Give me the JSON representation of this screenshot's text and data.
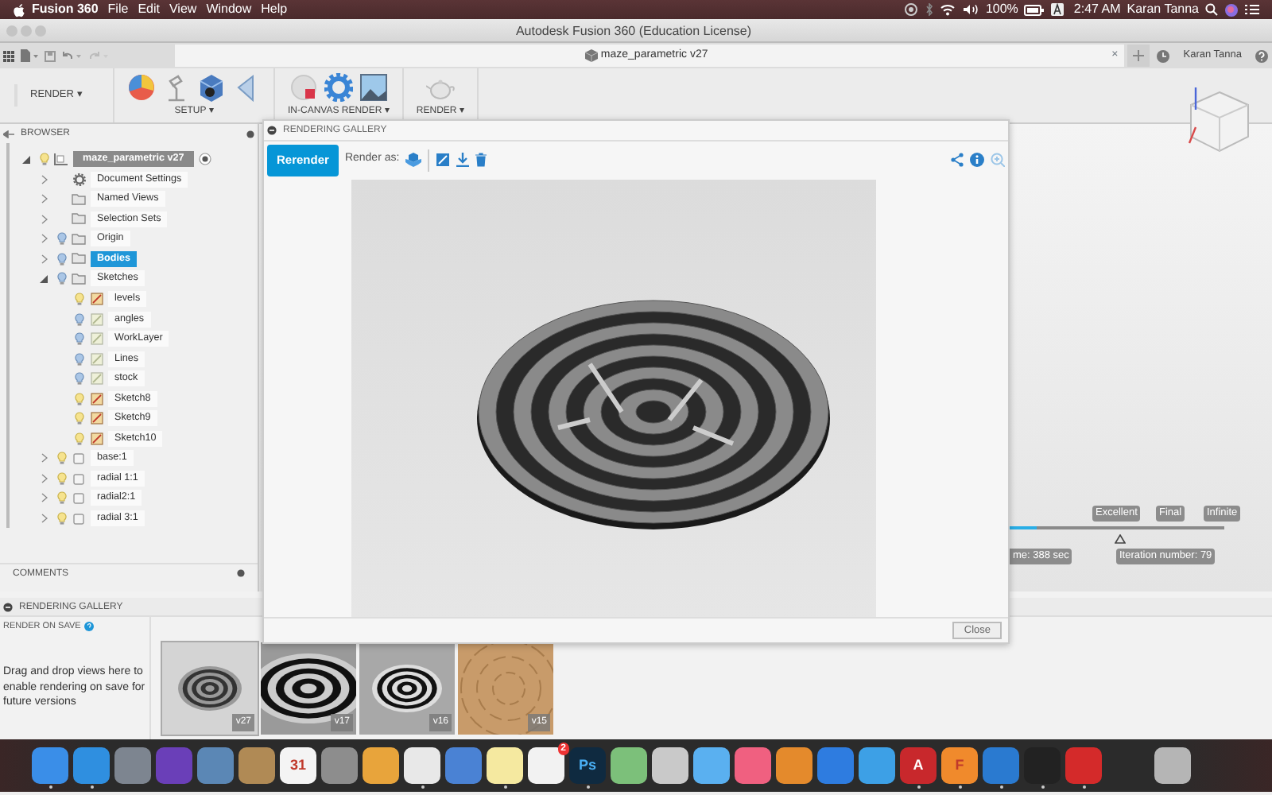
{
  "menu_bar": {
    "app": "Fusion 360",
    "menus": [
      "File",
      "Edit",
      "View",
      "Window",
      "Help"
    ],
    "battery": "100%",
    "clock": "2:47 AM",
    "user": "Karan Tanna"
  },
  "window": {
    "title": "Autodesk Fusion 360 (Education License)"
  },
  "document_tab": {
    "title": "maze_parametric v27",
    "close": "×"
  },
  "account": {
    "user": "Karan Tanna"
  },
  "toolbar": {
    "workspace": "RENDER ▾",
    "groups": [
      {
        "label": "SETUP ▾",
        "tools": [
          {
            "kind": "appearance"
          },
          {
            "kind": "lamp"
          },
          {
            "kind": "cube"
          },
          {
            "kind": "wedge"
          }
        ]
      },
      {
        "label": "IN-CANVAS RENDER ▾",
        "tools": [
          {
            "kind": "sphere"
          },
          {
            "kind": "gear"
          },
          {
            "kind": "picture"
          }
        ]
      },
      {
        "label": "RENDER ▾",
        "tools": [
          {
            "kind": "teapot"
          }
        ]
      }
    ]
  },
  "browser": {
    "title": "BROWSER",
    "tree": [
      {
        "label": "maze_parametric v27",
        "kind": "component",
        "visible": true,
        "expanded": true,
        "selected": false,
        "children": [
          {
            "label": "Document Settings",
            "kind": "settings",
            "expanded": false,
            "selected": false
          },
          {
            "label": "Named Views",
            "kind": "folder",
            "expanded": false,
            "selected": false
          },
          {
            "label": "Selection Sets",
            "kind": "folder",
            "expanded": false,
            "selected": false
          },
          {
            "label": "Origin",
            "kind": "folder",
            "visible": false,
            "expanded": false,
            "selected": false
          },
          {
            "label": "Bodies",
            "kind": "folder",
            "visible": false,
            "expanded": false,
            "selected": true
          },
          {
            "label": "Sketches",
            "kind": "folder",
            "visible": false,
            "expanded": true,
            "selected": false,
            "children": [
              {
                "label": "levels",
                "kind": "sketch",
                "visible": true,
                "selected": false
              },
              {
                "label": "angles",
                "kind": "sketch",
                "visible": false,
                "selected": false
              },
              {
                "label": "WorkLayer",
                "kind": "sketch",
                "visible": false,
                "selected": false
              },
              {
                "label": "Lines",
                "kind": "sketch",
                "visible": false,
                "selected": false
              },
              {
                "label": "stock",
                "kind": "sketch",
                "visible": false,
                "selected": false
              },
              {
                "label": "Sketch8",
                "kind": "sketch",
                "visible": true,
                "selected": false
              },
              {
                "label": "Sketch9",
                "kind": "sketch",
                "visible": true,
                "selected": false
              },
              {
                "label": "Sketch10",
                "kind": "sketch",
                "visible": true,
                "selected": false
              }
            ]
          },
          {
            "label": "base:1",
            "kind": "body",
            "visible": true,
            "expanded": false,
            "selected": false
          },
          {
            "label": "radial 1:1",
            "kind": "body",
            "visible": true,
            "expanded": false,
            "selected": false
          },
          {
            "label": "radial2:1",
            "kind": "body",
            "visible": true,
            "expanded": false,
            "selected": false
          },
          {
            "label": "radial 3:1",
            "kind": "body",
            "visible": true,
            "expanded": false,
            "selected": false
          }
        ]
      }
    ]
  },
  "comments": {
    "title": "COMMENTS"
  },
  "dialog": {
    "title": "RENDERING GALLERY",
    "rerender": "Rerender",
    "render_as": "Render as:",
    "close": "Close"
  },
  "render_progress": {
    "quality_labels": [
      "Excellent",
      "Final",
      "Infinite"
    ],
    "level": 0.44,
    "time": "me: 388 sec",
    "iteration": "Iteration number: 79"
  },
  "gallery": {
    "title": "RENDERING GALLERY",
    "render_on_save": "RENDER ON SAVE",
    "hint": "Drag and drop views here to enable rendering on save for future versions",
    "thumbnails": [
      {
        "label": "v27",
        "kind": "top",
        "selected": true
      },
      {
        "label": "v17",
        "kind": "closeup",
        "selected": false
      },
      {
        "label": "v16",
        "kind": "dark",
        "selected": false
      },
      {
        "label": "v15",
        "kind": "wood",
        "selected": false
      }
    ]
  },
  "dock": [
    {
      "color": "#3a8ee8",
      "running": true
    },
    {
      "color": "#2f8fe0",
      "running": true
    },
    {
      "color": "#7d8590",
      "running": false
    },
    {
      "color": "#6a3fb8",
      "running": false
    },
    {
      "color": "#5b87b5",
      "running": false
    },
    {
      "color": "#b08a55",
      "running": false
    },
    {
      "color": "#f4f4f4",
      "glyph": "31",
      "running": false
    },
    {
      "color": "#8d8d8d",
      "running": false
    },
    {
      "color": "#e8a43b",
      "running": false
    },
    {
      "color": "#e8e8e8",
      "running": true
    },
    {
      "color": "#4a82d4",
      "running": false
    },
    {
      "color": "#f5e9a0",
      "running": true
    },
    {
      "color": "#f2f2f2",
      "badge": "2",
      "running": false
    },
    {
      "color": "#0f2a40",
      "glyph": "Ps",
      "running": true
    },
    {
      "color": "#7cc07a",
      "running": false
    },
    {
      "color": "#c9c9c9",
      "running": false
    },
    {
      "color": "#5ab0f0",
      "running": false
    },
    {
      "color": "#f06080",
      "running": false
    },
    {
      "color": "#e48a2c",
      "running": false
    },
    {
      "color": "#2e7ce0",
      "running": false
    },
    {
      "color": "#3da0e6",
      "running": false
    },
    {
      "color": "#c8282c",
      "glyph": "A",
      "running": true
    },
    {
      "color": "#f08a2c",
      "glyph": "F",
      "running": true
    },
    {
      "color": "#2a7ad0",
      "running": true
    },
    {
      "color": "#222222",
      "running": true
    },
    {
      "color": "#d42a2a",
      "running": true
    },
    {
      "color": "#b5b5b5",
      "running": false
    }
  ]
}
